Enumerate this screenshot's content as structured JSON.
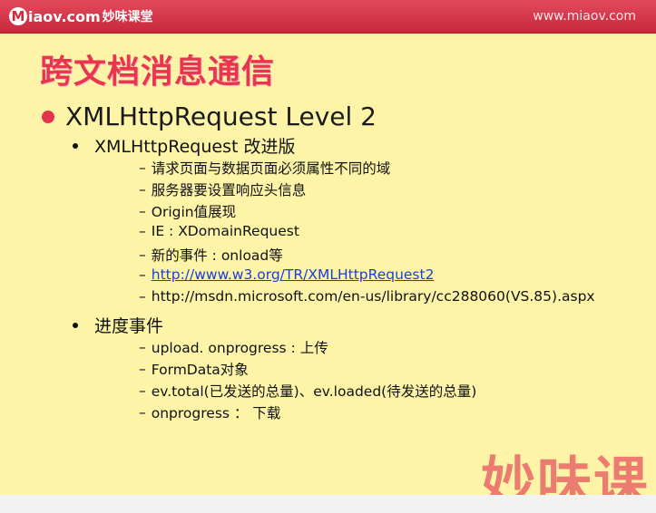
{
  "header": {
    "logo_text": "iaov.com",
    "logo_letter": "M",
    "logo_cn": "妙味课堂",
    "site_url": "www.miaov.com"
  },
  "title": "跨文档消息通信",
  "level1": "XMLHttpRequest Level 2",
  "sections": [
    {
      "label": "XMLHttpRequest 改进版",
      "items": [
        "请求页面与数据页面必须属性不同的域",
        "服务器要设置响应头信息",
        "Origin值展现",
        "IE : XDomainRequest",
        "新的事件 : onload等",
        "http://www.w3.org/TR/XMLHttpRequest2",
        "http://msdn.microsoft.com/en-us/library/cc288060(VS.85).aspx"
      ]
    },
    {
      "label": "进度事件",
      "items": [
        "upload. onprogress : 上传",
        "FormData对象",
        "ev.total(已发送的总量)、ev.loaded(待发送的总量)",
        "onprogress ： 下载"
      ]
    }
  ],
  "watermark": "妙味课"
}
